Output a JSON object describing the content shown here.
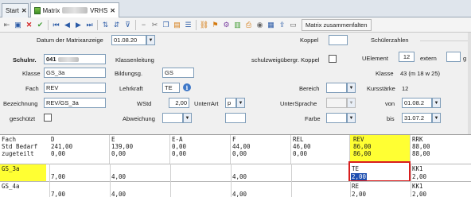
{
  "tabs": [
    {
      "label": "Start",
      "close": "✕"
    },
    {
      "label": "Matrix",
      "suffix": "VRHS",
      "close": "✕"
    }
  ],
  "toolbar": {
    "collapse_label": "Matrix zusammenfalten"
  },
  "form": {
    "datum_label": "Datum der Matrixanzeige",
    "datum_value": "01.08.20",
    "koppel_label": "Koppel",
    "schuelerzahlen_label": "Schülerzahlen",
    "schulnr_label": "Schulnr.",
    "schulnr_value": "041",
    "klassenleitung_label": "Klassenleitung",
    "schulzweig_label": "schulzweigübergr. Koppel",
    "uelement_label": "UElement",
    "uelement_value": "12",
    "extern_label": "extern",
    "g_label": "g",
    "klasse_label": "Klasse",
    "klasse_value": "GS_3a",
    "bildungsg_label": "Bildungsg.",
    "bildungsg_value": "GS",
    "klasse2_label": "Klasse",
    "klasse2_value": "43 (m 18 w 25)",
    "fach_label": "Fach",
    "fach_value": "REV",
    "lehrkraft_label": "Lehrkraft",
    "lehrkraft_value": "TE",
    "bereich_label": "Bereich",
    "kursstaerke_label": "Kursstärke",
    "kursstaerke_value": "12",
    "bezeichnung_label": "Bezeichnung",
    "bezeichnung_value": "REV/GS_3a",
    "wstd_label": "WStd",
    "wstd_value": "2,00",
    "unterrart_label": "UnterrArt",
    "unterrart_value": "p",
    "untersprache_label": "UnterSprache",
    "von_label": "von",
    "von_value": "01.08.2",
    "geschuetzt_label": "geschützt",
    "abweichung_label": "Abweichung",
    "farbe_label": "Farbe",
    "bis_label": "bis",
    "bis_value": "31.07.2"
  },
  "grid": {
    "header_rows": [
      "Fach",
      "Std Bedarf",
      "zugeteilt"
    ],
    "columns": [
      {
        "fach": "D",
        "bedarf": "241,00",
        "zugeteilt": "0,00"
      },
      {
        "fach": "E",
        "bedarf": "139,00",
        "zugeteilt": "0,00"
      },
      {
        "fach": "E-A",
        "bedarf": "0,00",
        "zugeteilt": "0,00"
      },
      {
        "fach": "F",
        "bedarf": "44,00",
        "zugeteilt": "0,00"
      },
      {
        "fach": "REL",
        "bedarf": "46,00",
        "zugeteilt": "0,00"
      },
      {
        "fach": "REV",
        "bedarf": "86,00",
        "zugeteilt": "86,00"
      },
      {
        "fach": "RRK",
        "bedarf": "88,00",
        "zugeteilt": "88,00"
      }
    ],
    "rows": [
      {
        "klasse": "GS_3a",
        "cells": [
          "7,00",
          "4,00",
          "",
          "4,00",
          "",
          "TE|2,00",
          "KK1|2,00"
        ]
      },
      {
        "klasse": "GS_4a",
        "cells": [
          "7,00",
          "4,00",
          "",
          "4,00",
          "",
          "RE|2,00",
          "KK1|2,00"
        ]
      }
    ]
  },
  "colors": {
    "highlight": "#ffff33",
    "selection_border": "#d81e1e",
    "edit_bg": "#1f4fb0"
  }
}
